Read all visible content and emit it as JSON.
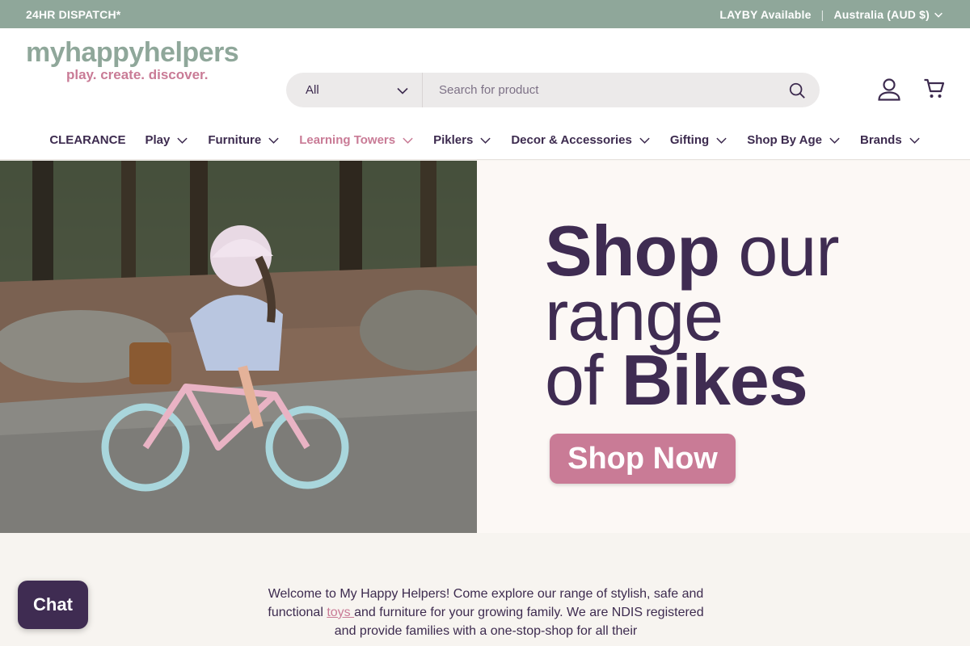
{
  "topbar": {
    "dispatch": "24HR DISPATCH*",
    "layby": "LAYBY Available",
    "separator": "|",
    "region": "Australia (AUD $)"
  },
  "logo": {
    "name": "myhappyhelpers",
    "tagline": "play. create. discover."
  },
  "search": {
    "category": "All",
    "placeholder": "Search for product"
  },
  "nav": [
    {
      "label": "CLEARANCE",
      "has_dropdown": false
    },
    {
      "label": "Play",
      "has_dropdown": true
    },
    {
      "label": "Furniture",
      "has_dropdown": true
    },
    {
      "label": "Learning Towers",
      "has_dropdown": true,
      "active": true
    },
    {
      "label": "Piklers",
      "has_dropdown": true
    },
    {
      "label": "Decor & Accessories",
      "has_dropdown": true
    },
    {
      "label": "Gifting",
      "has_dropdown": true
    },
    {
      "label": "Shop By Age",
      "has_dropdown": true
    },
    {
      "label": "Brands",
      "has_dropdown": true
    }
  ],
  "hero": {
    "line1_bold": "Shop",
    "line1_light": " our",
    "line2": "range",
    "line3_light": "of ",
    "line3_bold": "Bikes",
    "button": "Shop Now"
  },
  "welcome": {
    "part1": "Welcome to My Happy Helpers! Come explore our range of stylish, safe and functional ",
    "link_toys": "toys ",
    "part2": "and furniture for your growing family. We are NDIS registered and provide families with a one-stop-shop for all their"
  },
  "chat": {
    "label": "Chat"
  },
  "colors": {
    "topbar": "#8fa79a",
    "accent": "#c97b96",
    "text": "#3d2b4f",
    "hero_bg": "#fcf8f5"
  }
}
